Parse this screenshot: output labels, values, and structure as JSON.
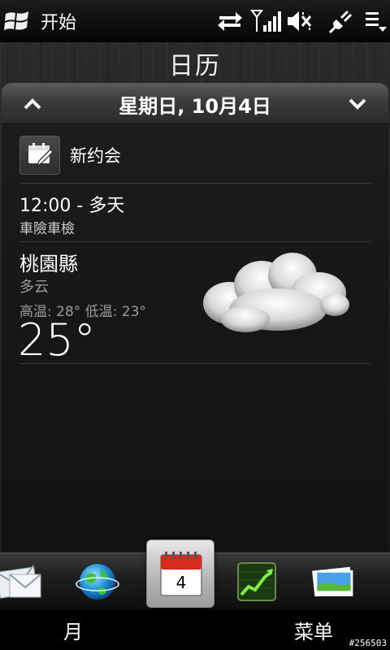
{
  "status_bar": {
    "start_label": "开始",
    "icons": [
      "windows-flag-icon",
      "data-sync-icon",
      "signal-strength-icon",
      "speaker-mute-icon",
      "power-plug-icon",
      "menu-icon"
    ]
  },
  "app": {
    "title": "日历"
  },
  "date_bar": {
    "date": "星期日, 10月4日"
  },
  "new_appointment": {
    "label": "新约会"
  },
  "appointment": {
    "time": "12:00 - 多天",
    "subject": "車險車檢"
  },
  "weather": {
    "city": "桃園縣",
    "condition": "多云",
    "hi_lo": "高温: 28° 低温: 23°",
    "temperature": "25°",
    "icon": "cloud-icon"
  },
  "dock": {
    "items": [
      "mail-icon",
      "internet-globe-icon",
      "calendar-icon",
      "stocks-icon",
      "photos-icon"
    ],
    "active_calendar_day": "4"
  },
  "softkeys": {
    "left": "月",
    "right": "菜单"
  },
  "watermark": "#256503",
  "colors": {
    "calendar_red": "#d62a1e",
    "stocks_green": "#3fae2a"
  }
}
